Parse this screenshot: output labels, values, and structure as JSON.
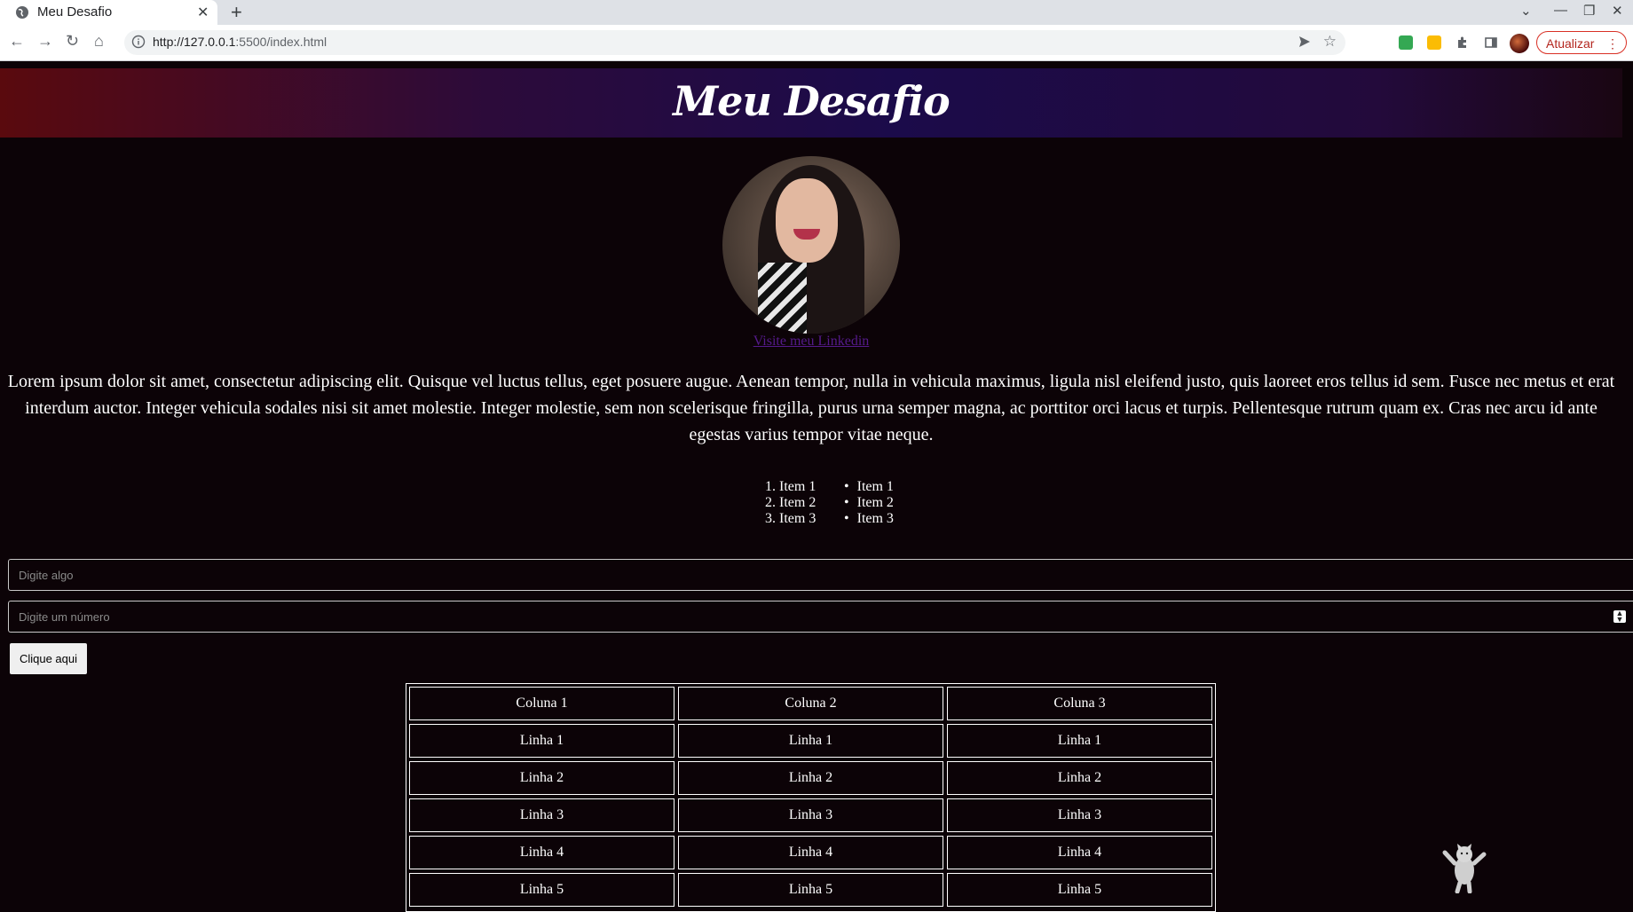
{
  "browser": {
    "tab_title": "Meu Desafio",
    "new_tab_symbol": "+",
    "close_symbol": "✕",
    "url_host": "http://127.0.0.1",
    "url_rest": ":5500/index.html",
    "update_label": "Atualizar",
    "update_menu_symbol": "⋮",
    "window_controls": [
      "⌄",
      "—",
      "❐",
      "✕"
    ],
    "extension_colors": [
      "#34a853",
      "#fbbc04",
      "#5f6368"
    ]
  },
  "page": {
    "title": "Meu Desafio",
    "linkedin_text": "Visite meu Linkedin",
    "paragraph": "Lorem ipsum dolor sit amet, consectetur adipiscing elit. Quisque vel luctus tellus, eget posuere augue. Aenean tempor, nulla in vehicula maximus, ligula nisl eleifend justo, quis laoreet eros tellus id sem. Fusce nec metus et erat interdum auctor. Integer vehicula sodales nisi sit amet molestie. Integer molestie, sem non scelerisque fringilla, purus urna semper magna, ac porttitor orci lacus et turpis. Pellentesque rutrum quam ex. Cras nec arcu id ante egestas varius tempor vitae neque.",
    "ordered_list": [
      "1. Item 1",
      "2. Item 2",
      "3. Item 3"
    ],
    "unordered_list": [
      "Item 1",
      "Item 2",
      "Item 3"
    ],
    "text_input_placeholder": "Digite algo",
    "number_input_placeholder": "Digite um número",
    "button_label": "Clique aqui",
    "table": {
      "headers": [
        "Coluna 1",
        "Coluna 2",
        "Coluna 3"
      ],
      "rows": [
        [
          "Linha 1",
          "Linha 1",
          "Linha 1"
        ],
        [
          "Linha 2",
          "Linha 2",
          "Linha 2"
        ],
        [
          "Linha 3",
          "Linha 3",
          "Linha 3"
        ],
        [
          "Linha 4",
          "Linha 4",
          "Linha 4"
        ],
        [
          "Linha 5",
          "Linha 5",
          "Linha 5"
        ]
      ]
    }
  }
}
